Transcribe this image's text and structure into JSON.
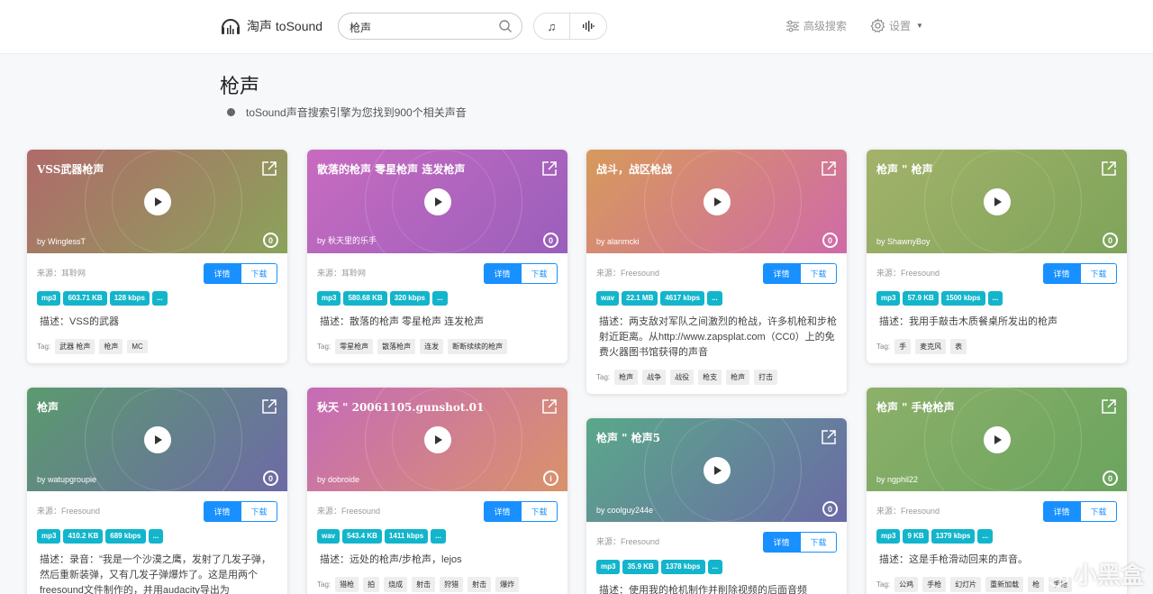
{
  "header": {
    "logo_text": "淘声 toSound",
    "search_value": "枪声",
    "mode_music_icon": "♫",
    "mode_wave_icon": "wave-icon",
    "advanced_search_label": "高级搜索",
    "settings_label": "设置"
  },
  "page": {
    "title": "枪声",
    "result_text": "toSound声音搜索引擎为您找到900个相关声音"
  },
  "labels": {
    "detail": "详情",
    "download": "下载",
    "tag": "Tag:"
  },
  "cards": [
    {
      "title": "VSS武器枪声",
      "author": "by WinglessT",
      "license": "0",
      "source": "来源：耳聆网",
      "format": "mp3",
      "size": "603.71 KB",
      "bitrate": "128 kbps",
      "more": "...",
      "desc": "描述：VSS的武器",
      "tags": [
        "武器 枪声",
        "枪声",
        "MC"
      ],
      "colors": [
        "#b06a6a",
        "#8aa35a"
      ]
    },
    {
      "title": "散落的枪声 零星枪声 连发枪声",
      "author": "by 秋天里的乐手",
      "license": "0",
      "source": "来源：耳聆网",
      "format": "mp3",
      "size": "580.68 KB",
      "bitrate": "320 kbps",
      "more": "...",
      "desc": "描述：散落的枪声 零星枪声 连发枪声",
      "tags": [
        "零星枪声",
        "散落枪声",
        "连发",
        "断断续续的枪声"
      ],
      "colors": [
        "#c86bc0",
        "#9a5fbc"
      ]
    },
    {
      "title": "战斗，战区枪战",
      "author": "by alanmcki",
      "license": "0",
      "source": "来源：Freesound",
      "format": "wav",
      "size": "22.1 MB",
      "bitrate": "4617 kbps",
      "more": "...",
      "desc": "描述：两支敌对军队之间激烈的枪战，许多机枪和步枪射近距离。从http://www.zapsplat.com（CC0）上的免费火器图书馆获得的声音",
      "tags": [
        "枪声",
        "战争",
        "战役",
        "枪支",
        "枪声",
        "打击"
      ],
      "colors": [
        "#d79a5a",
        "#d06aa8"
      ]
    },
    {
      "title": "枪声 \" 枪声",
      "author": "by ShawnyBoy",
      "license": "0",
      "source": "来源：Freesound",
      "format": "mp3",
      "size": "57.9 KB",
      "bitrate": "1500 kbps",
      "more": "...",
      "desc": "描述：我用手敲击木质餐桌所发出的枪声",
      "tags": [
        "手",
        "麦克风",
        "表"
      ],
      "colors": [
        "#a3b26a",
        "#7ea45a"
      ]
    },
    {
      "title": "枪声",
      "author": "by watupgroupie",
      "license": "0",
      "source": "来源：Freesound",
      "format": "mp3",
      "size": "410.2 KB",
      "bitrate": "689 kbps",
      "more": "...",
      "desc": "描述：录音：\"我是一个沙漠之鹰，发射了几发子弹，然后重新装弹，又有几发子弹爆炸了。这是用两个freesound文件制作的，并用audacity导出为",
      "tags": [],
      "colors": [
        "#5b9a6e",
        "#6d6aa6"
      ]
    },
    {
      "title": "秋天 \" 20061105.gunshot.01",
      "author": "by dobroide",
      "license": "i",
      "source": "来源：Freesound",
      "format": "wav",
      "size": "543.4 KB",
      "bitrate": "1411 kbps",
      "more": "...",
      "desc": "描述：远处的枪声/步枪声，lejos",
      "tags": [
        "猎枪",
        "拍",
        "烧成",
        "射击",
        "狩猎",
        "射击",
        "爆炸"
      ],
      "colors": [
        "#c66bb8",
        "#d9926a"
      ]
    },
    {
      "title": "枪声 \" 枪声5",
      "author": "by coolguy244e",
      "license": "0",
      "source": "来源：Freesound",
      "format": "mp3",
      "size": "35.9 KB",
      "bitrate": "1378 kbps",
      "more": "...",
      "desc": "描述：使用我的枪机制作并削除视频的后面音频",
      "tags": [],
      "colors": [
        "#5aa88a",
        "#6b6aa6"
      ]
    },
    {
      "title": "枪声 \" 手枪枪声",
      "author": "by ngphil22",
      "license": "0",
      "source": "来源：Freesound",
      "format": "mp3",
      "size": "9 KB",
      "bitrate": "1379 kbps",
      "more": "...",
      "desc": "描述：这是手枪滑动回来的声音。",
      "tags": [
        "公鸡",
        "手枪",
        "幻灯片",
        "重新加载",
        "枪",
        "手枪"
      ],
      "colors": [
        "#8cb06a",
        "#6aa45e"
      ]
    }
  ],
  "watermark_text": "小黑盒"
}
